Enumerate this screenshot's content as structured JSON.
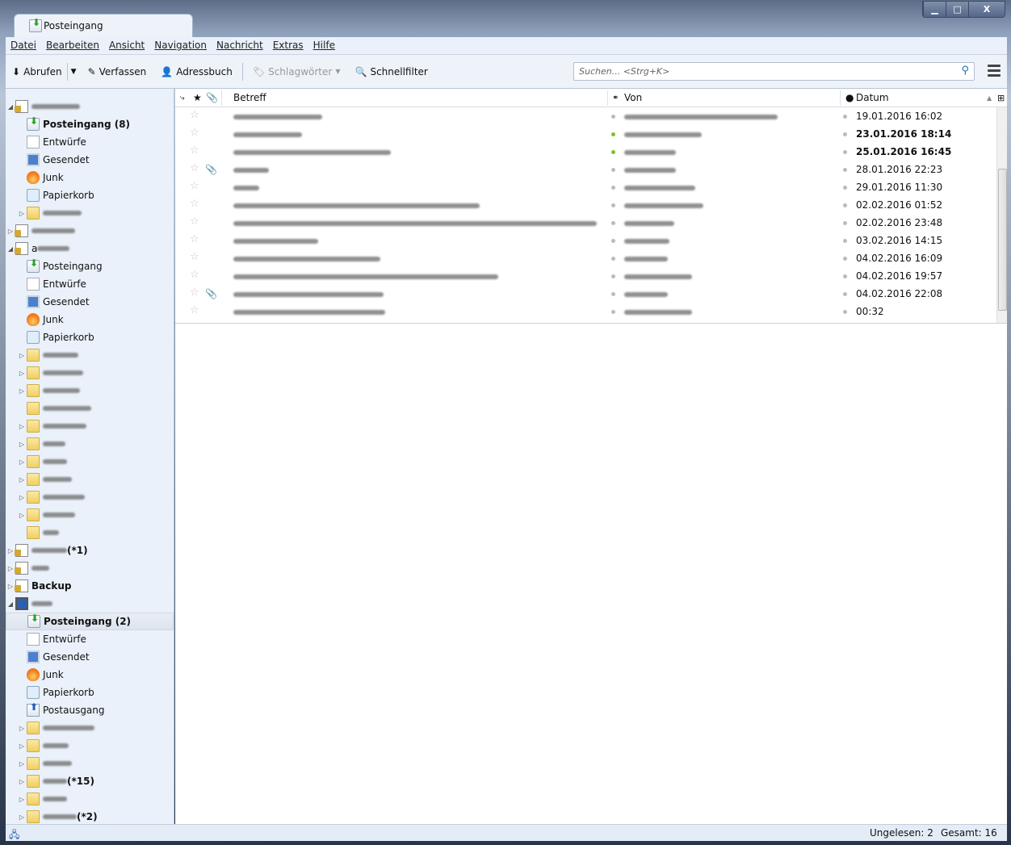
{
  "window": {
    "tab_title": "Posteingang",
    "controls": [
      "minimize",
      "maximize",
      "close"
    ]
  },
  "menu": [
    "Datei",
    "Bearbeiten",
    "Ansicht",
    "Navigation",
    "Nachricht",
    "Extras",
    "Hilfe"
  ],
  "toolbar": {
    "get": "Abrufen",
    "compose": "Verfassen",
    "addressbook": "Adressbuch",
    "tags": "Schlagwörter",
    "quickfilter": "Schnellfilter"
  },
  "search": {
    "placeholder": "Suchen... <Strg+K>"
  },
  "columns": {
    "subject": "Betreff",
    "from": "Von",
    "date": "Datum"
  },
  "folders": [
    {
      "type": "acct",
      "level": 0,
      "exp": "open",
      "blur": 60
    },
    {
      "type": "inbox",
      "level": 1,
      "label": "Posteingang (8)",
      "bold": true
    },
    {
      "type": "draft",
      "level": 1,
      "label": "Entwürfe"
    },
    {
      "type": "sent",
      "level": 1,
      "label": "Gesendet"
    },
    {
      "type": "junk",
      "level": 1,
      "label": "Junk"
    },
    {
      "type": "trash",
      "level": 1,
      "label": "Papierkorb"
    },
    {
      "type": "folder",
      "level": 1,
      "exp": "closed",
      "blur": 48
    },
    {
      "type": "acct",
      "level": 0,
      "exp": "closed",
      "blur": 54
    },
    {
      "type": "acct",
      "level": 0,
      "exp": "open",
      "label": "a",
      "blur": 40
    },
    {
      "type": "inbox",
      "level": 1,
      "label": "Posteingang"
    },
    {
      "type": "draft",
      "level": 1,
      "label": "Entwürfe"
    },
    {
      "type": "sent",
      "level": 1,
      "label": "Gesendet"
    },
    {
      "type": "junk",
      "level": 1,
      "label": "Junk"
    },
    {
      "type": "trash",
      "level": 1,
      "label": "Papierkorb"
    },
    {
      "type": "folder",
      "level": 1,
      "exp": "closed",
      "blur": 44
    },
    {
      "type": "folder",
      "level": 1,
      "exp": "closed",
      "blur": 50
    },
    {
      "type": "folder",
      "level": 1,
      "exp": "closed",
      "blur": 46
    },
    {
      "type": "folder",
      "level": 1,
      "blur": 60
    },
    {
      "type": "folder",
      "level": 1,
      "exp": "closed",
      "blur": 54
    },
    {
      "type": "folder",
      "level": 1,
      "exp": "closed",
      "blur": 28
    },
    {
      "type": "folder",
      "level": 1,
      "exp": "closed",
      "blur": 30
    },
    {
      "type": "folder",
      "level": 1,
      "exp": "closed",
      "blur": 36
    },
    {
      "type": "folder",
      "level": 1,
      "exp": "closed",
      "blur": 52
    },
    {
      "type": "folder",
      "level": 1,
      "exp": "closed",
      "blur": 40
    },
    {
      "type": "folder",
      "level": 1,
      "blur": 20
    },
    {
      "type": "acct",
      "level": 0,
      "exp": "closed",
      "blur": 44,
      "suffix": "(*1)"
    },
    {
      "type": "acct",
      "level": 0,
      "exp": "closed",
      "blur": 22
    },
    {
      "type": "acct",
      "level": 0,
      "exp": "closed",
      "label": "Backup",
      "bold": true
    },
    {
      "type": "local",
      "level": 0,
      "exp": "open",
      "blur": 26
    },
    {
      "type": "inbox",
      "level": 1,
      "label": "Posteingang (2)",
      "bold": true,
      "selected": true
    },
    {
      "type": "draft",
      "level": 1,
      "label": "Entwürfe"
    },
    {
      "type": "sent",
      "level": 1,
      "label": "Gesendet"
    },
    {
      "type": "junk",
      "level": 1,
      "label": "Junk"
    },
    {
      "type": "trash",
      "level": 1,
      "label": "Papierkorb"
    },
    {
      "type": "out",
      "level": 1,
      "label": "Postausgang"
    },
    {
      "type": "folder",
      "level": 1,
      "exp": "closed",
      "blur": 64
    },
    {
      "type": "folder",
      "level": 1,
      "exp": "closed",
      "blur": 32
    },
    {
      "type": "folder",
      "level": 1,
      "exp": "closed",
      "blur": 36
    },
    {
      "type": "folder",
      "level": 1,
      "exp": "closed",
      "blur": 30,
      "suffix": "(*15)",
      "bold": true
    },
    {
      "type": "folder",
      "level": 1,
      "exp": "closed",
      "blur": 30
    },
    {
      "type": "folder",
      "level": 1,
      "exp": "closed",
      "blur": 42,
      "suffix": "(*2)",
      "bold": true
    }
  ],
  "messages": [
    {
      "date": "19.01.2016 16:02",
      "subj_blur": 110,
      "from_blur": 190
    },
    {
      "date": "23.01.2016 18:14",
      "bold": true,
      "unread": true,
      "subj_blur": 85,
      "from_blur": 96
    },
    {
      "date": "25.01.2016 16:45",
      "bold": true,
      "unread": true,
      "subj_blur": 195,
      "from_blur": 64
    },
    {
      "date": "28.01.2016 22:23",
      "attachment": true,
      "subj_blur": 44,
      "from_blur": 64
    },
    {
      "date": "29.01.2016 11:30",
      "subj_blur": 32,
      "from_blur": 88
    },
    {
      "date": "02.02.2016 01:52",
      "subj_blur": 305,
      "from_blur": 98
    },
    {
      "date": "02.02.2016 23:48",
      "subj_blur": 450,
      "from_blur": 62
    },
    {
      "date": "03.02.2016 14:15",
      "subj_blur": 105,
      "from_blur": 56
    },
    {
      "date": "04.02.2016 16:09",
      "subj_blur": 182,
      "from_blur": 54
    },
    {
      "date": "04.02.2016 19:57",
      "subj_blur": 328,
      "from_blur": 84
    },
    {
      "date": "04.02.2016 22:08",
      "attachment": true,
      "subj_blur": 186,
      "from_blur": 54
    },
    {
      "date": "00:32",
      "subj_blur": 188,
      "from_blur": 84
    }
  ],
  "status": {
    "unread": "Ungelesen: 2",
    "total": "Gesamt: 16"
  },
  "colors": {
    "accent": "#2a70b8",
    "unread_dot": "#7cc31e",
    "attachment": "#b08a20"
  }
}
